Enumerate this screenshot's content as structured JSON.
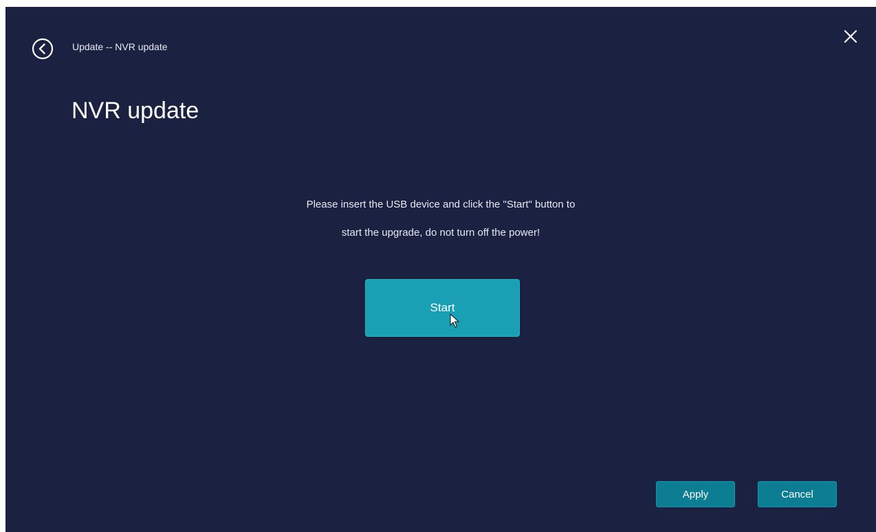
{
  "header": {
    "breadcrumb": "Update -- NVR update",
    "back_icon": "back-icon",
    "close_icon": "close-icon"
  },
  "main": {
    "title": "NVR update",
    "message_line1": "Please insert the USB device and click the \"Start\" button to",
    "message_line2": "start the upgrade, do not turn off the power!",
    "start_label": "Start"
  },
  "footer": {
    "apply_label": "Apply",
    "cancel_label": "Cancel"
  },
  "colors": {
    "background": "#1b2140",
    "accent": "#1aa0b5",
    "footer_button": "#0c7d92"
  }
}
